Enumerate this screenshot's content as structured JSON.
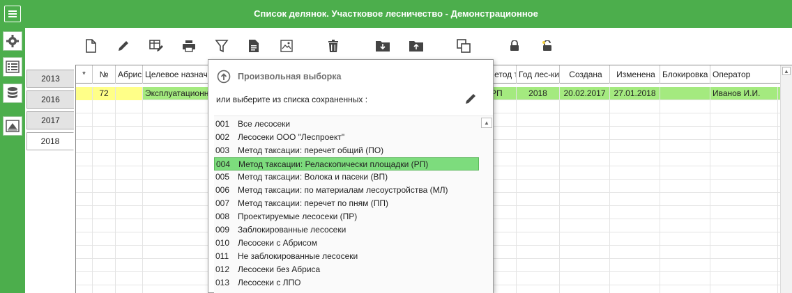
{
  "window": {
    "title": "Список делянок. Участковое лесничество - Демонстрационное"
  },
  "colors": {
    "accent": "#4cae4c",
    "selected_row": "#a4ea7f",
    "highlight_item": "#7ddc7d",
    "abris_cell": "#ffff88"
  },
  "sidebar": {
    "icons": [
      "menu-icon",
      "gear-icon",
      "list-icon",
      "database-icon",
      "chart-icon"
    ]
  },
  "toolbar": {
    "icons": [
      "new-document-icon",
      "edit-pencil-icon",
      "table-edit-icon",
      "print-icon",
      "filter-icon",
      "document-icon",
      "map-icon",
      "trash-icon",
      "import-folder-icon",
      "export-folder-icon",
      "copy-icon",
      "lock-icon",
      "unlock-icon"
    ]
  },
  "years": {
    "tabs": [
      "2013",
      "2016",
      "2017",
      "2018"
    ],
    "active": "2018"
  },
  "table": {
    "headers": {
      "star": "*",
      "num": "№",
      "abris": "Абрис",
      "purpose": "Целевое назначение",
      "method": "Метод таксации",
      "year": "Год лес-ки",
      "created": "Создана",
      "modified": "Изменена",
      "locked": "Блокировка",
      "operator": "Оператор"
    },
    "rows": [
      {
        "star": "",
        "num": "72",
        "abris": "",
        "purpose": "Эксплуатационные леса",
        "method": "РП",
        "year": "2018",
        "created": "20.02.2017",
        "modified": "27.01.2018",
        "locked": "",
        "operator": "Иванов И.И."
      }
    ]
  },
  "popup": {
    "title": "Произвольная выборка",
    "subtitle": "или выберите из списка сохраненных :",
    "selected_index": 3,
    "items": [
      {
        "code": "001",
        "name": "Все лесосеки"
      },
      {
        "code": "002",
        "name": "Лесосеки ООО \"Леспроект\""
      },
      {
        "code": "003",
        "name": "Метод таксации: перечет общий (ПО)"
      },
      {
        "code": "004",
        "name": "Метод таксации: Реласкопически площадки (РП)"
      },
      {
        "code": "005",
        "name": "Метод таксации: Волока и пасеки (ВП)"
      },
      {
        "code": "006",
        "name": "Метод таксации: по материалам лесоустройства (МЛ)"
      },
      {
        "code": "007",
        "name": "Метод таксации: перечет по пням (ПП)"
      },
      {
        "code": "008",
        "name": "Проектируемые лесосеки (ПР)"
      },
      {
        "code": "009",
        "name": "Заблокированные лесосеки"
      },
      {
        "code": "010",
        "name": "Лесосеки с Абрисом"
      },
      {
        "code": "011",
        "name": "Не заблокированные лесосеки"
      },
      {
        "code": "012",
        "name": "Лесосеки без Абриса"
      },
      {
        "code": "013",
        "name": "Лесосеки с ЛПО"
      }
    ]
  }
}
